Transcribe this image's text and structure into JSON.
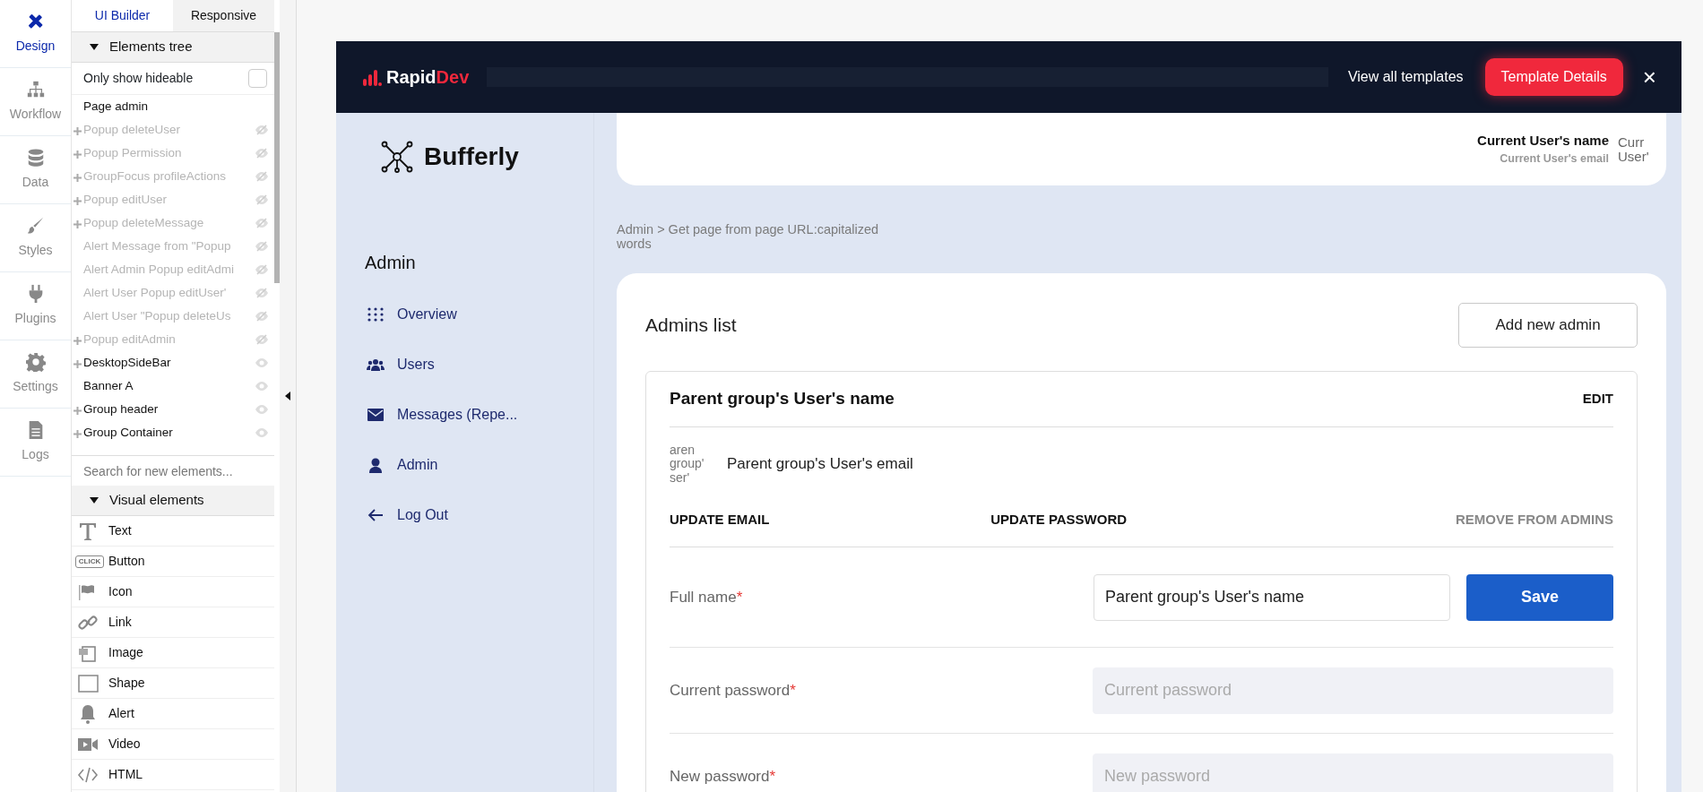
{
  "rail": [
    {
      "label": "Design",
      "selected": true
    },
    {
      "label": "Workflow",
      "selected": false
    },
    {
      "label": "Data",
      "selected": false
    },
    {
      "label": "Styles",
      "selected": false
    },
    {
      "label": "Plugins",
      "selected": false
    },
    {
      "label": "Settings",
      "selected": false
    },
    {
      "label": "Logs",
      "selected": false
    }
  ],
  "panel_tabs": [
    {
      "label": "UI Builder",
      "selected": true
    },
    {
      "label": "Responsive",
      "selected": false
    }
  ],
  "elements_tree": {
    "title": "Elements tree",
    "expanded": true,
    "filter": {
      "label": "Only show hideable",
      "checked": false
    },
    "root": {
      "label": "Page admin",
      "children": [
        {
          "label": "Popup deleteUser",
          "expandable": true,
          "hidden": true
        },
        {
          "label": "Popup Permission",
          "expandable": true,
          "hidden": true
        },
        {
          "label": "GroupFocus profileActions",
          "expandable": true,
          "hidden": true
        },
        {
          "label": "Popup editUser",
          "expandable": true,
          "hidden": true
        },
        {
          "label": "Popup deleteMessage",
          "expandable": true,
          "hidden": true
        },
        {
          "label": "Alert Message from \"Popup",
          "expandable": false,
          "hidden": true
        },
        {
          "label": "Alert Admin Popup editAdmi",
          "expandable": false,
          "hidden": true
        },
        {
          "label": "Alert User Popup editUser'",
          "expandable": false,
          "hidden": true
        },
        {
          "label": "Alert User \"Popup deleteUs",
          "expandable": false,
          "hidden": true
        },
        {
          "label": "Popup editAdmin",
          "expandable": true,
          "hidden": true
        },
        {
          "label": "DesktopSideBar",
          "expandable": true,
          "hidden": false
        },
        {
          "label": "Banner A",
          "expandable": false,
          "hidden": false
        },
        {
          "label": "Group header",
          "expandable": true,
          "hidden": false
        },
        {
          "label": "Group Container",
          "expandable": true,
          "hidden": false
        }
      ]
    }
  },
  "element_search": {
    "placeholder": "Search for new elements..."
  },
  "visual_elements": {
    "title": "Visual elements",
    "expanded": true,
    "items": [
      {
        "label": "Text"
      },
      {
        "label": "Button",
        "icon_text": "CLICK"
      },
      {
        "label": "Icon"
      },
      {
        "label": "Link"
      },
      {
        "label": "Image"
      },
      {
        "label": "Shape"
      },
      {
        "label": "Alert"
      },
      {
        "label": "Video"
      },
      {
        "label": "HTML"
      }
    ]
  },
  "preview": {
    "banner": {
      "logo_start": "Rapid",
      "logo_end": "Dev",
      "link": "View all templates",
      "button": "Template Details",
      "close": "×"
    },
    "sidebar": {
      "brand": "Bufferly",
      "heading": "Admin",
      "items": [
        {
          "label": "Overview"
        },
        {
          "label": "Users"
        },
        {
          "label": "Messages (Repe..."
        },
        {
          "label": "Admin"
        },
        {
          "label": "Log Out"
        }
      ]
    },
    "header": {
      "user_name": "Current User's name",
      "user_email": "Current User's email",
      "avatar_text": "Curr User'"
    },
    "breadcrumb": "Admin > Get page from page URL:capitalized words",
    "admins": {
      "title": "Admins list",
      "add_button": "Add new admin",
      "card": {
        "name": "Parent group's User's name",
        "edit": "EDIT",
        "avatar_text": "aren group' ser'",
        "email": "Parent group's User's email",
        "actions": [
          {
            "label": "UPDATE EMAIL",
            "disabled": false
          },
          {
            "label": "UPDATE PASSWORD",
            "disabled": false
          },
          {
            "label": "REMOVE FROM ADMINS",
            "disabled": true
          }
        ],
        "fields": [
          {
            "label": "Full name",
            "required_mark": "*",
            "value": "Parent group's User's name",
            "button": "Save"
          },
          {
            "label": "Current password",
            "required_mark": "*",
            "placeholder": "Current password"
          },
          {
            "label": "New password",
            "required_mark": "*",
            "placeholder": "New password"
          }
        ]
      }
    }
  }
}
